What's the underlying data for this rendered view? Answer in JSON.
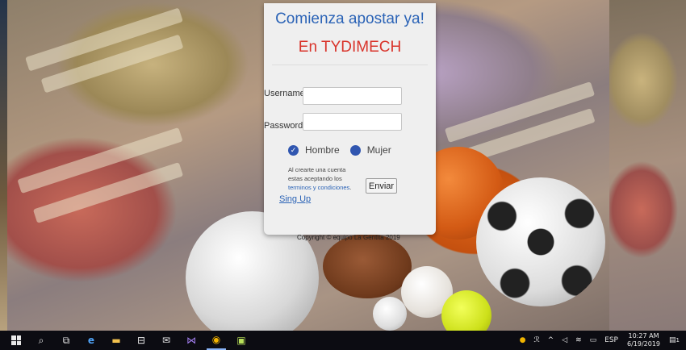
{
  "panel": {
    "title": "Comienza apostar ya!",
    "subtitle": "En TYDIMECH",
    "username_label": "Username",
    "password_label": "Password:",
    "username_value": "",
    "password_value": "",
    "gender_options": [
      "Hombre",
      "Mujer"
    ],
    "terms_text": "Al crearte una cuenta estas aceptando los",
    "terms_link": "terminos y condiciones",
    "terms_end": ".",
    "submit_label": "Enviar",
    "signup_label": "Sing Up",
    "copyright": "Copyright © equipo La Gentita 2019"
  },
  "taskbar": {
    "tray_language": "ESP",
    "time": "10:27 AM",
    "date": "6/19/2019",
    "notification_count": "1"
  },
  "colors": {
    "title_blue": "#2b63b6",
    "subtitle_red": "#d9342b",
    "radio_blue": "#3056b0"
  }
}
